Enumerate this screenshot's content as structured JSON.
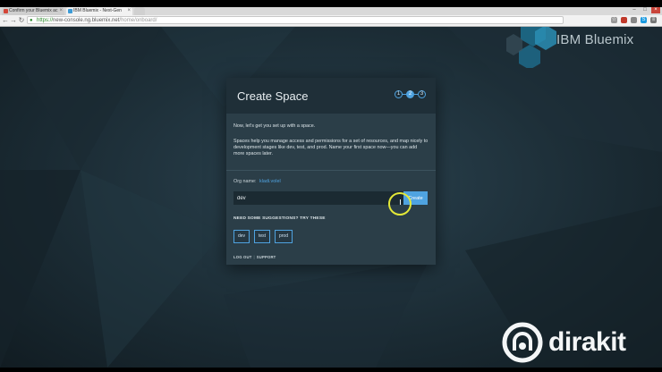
{
  "browser": {
    "tabs": [
      {
        "title": "Confirm your Bluemix ac",
        "favicon_color": "#d44638"
      },
      {
        "title": "IBM Bluemix - Next-Gen",
        "favicon_color": "#3c9bd6"
      }
    ],
    "url_scheme": "https://",
    "url_host": "new-console.ng.bluemix.net",
    "url_path": "/home/onboard/"
  },
  "brand": {
    "name": "IBM Bluemix",
    "colors": {
      "hex_dark": "#1d6a88",
      "hex_light": "#2a8db3"
    }
  },
  "dialog": {
    "title": "Create Space",
    "steps": [
      "1",
      "2",
      "3"
    ],
    "active_step": 2,
    "intro": "Now, let's get you set up with a space.",
    "description": "Spaces help you manage access and permissions for a set of resources, and map nicely to development stages like dev, test, and prod. Name your first space now—you can add more spaces later.",
    "org_label": "Org name:",
    "org_value": "kladi.volel",
    "space_name_value": "dev",
    "create_label": "Create",
    "suggestions_heading": "NEED SOME SUGGESTIONS? TRY THESE",
    "suggestions": [
      "dev",
      "test",
      "prod"
    ],
    "logout_label": "LOG OUT",
    "separator": "|",
    "support_label": "SUPPORT"
  },
  "watermark": {
    "text": "dirakit"
  },
  "colors": {
    "accent": "#4fa3e0",
    "cursor_highlight": "#e3e838",
    "dialog_bg": "#2b3e48",
    "dialog_header_bg": "#1f2f38"
  }
}
